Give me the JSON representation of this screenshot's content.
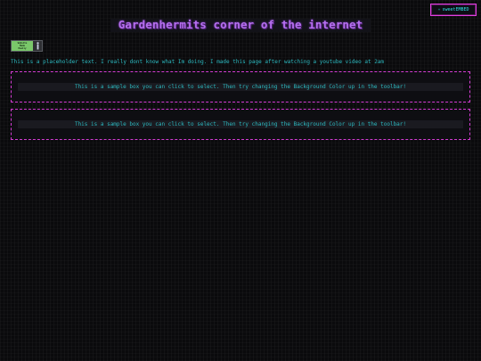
{
  "badge": {
    "icon": "sparkle-icon",
    "label": "sweetEMBED"
  },
  "header": {
    "title": "Gardenhermits corner of the internet"
  },
  "button88": {
    "label_lines": [
      "Website",
      "Made",
      "Easily"
    ],
    "icon": "figure-icon"
  },
  "intro": {
    "text": "This is a placeholder text. I really dont know what Im doing. I made this page after watching a youtube video at 2am"
  },
  "boxes": [
    {
      "text": "This is a sample box you can click to select. Then try changing the Background Color up in the toolbar!"
    },
    {
      "text": "This is a sample box you can click to select. Then try changing the Background Color up in the toolbar!"
    }
  ],
  "colors": {
    "background": "#0a0a0c",
    "accent_pink": "#d43cd4",
    "text_cyan": "#21c7c9",
    "title_purple": "#b66ff0"
  }
}
